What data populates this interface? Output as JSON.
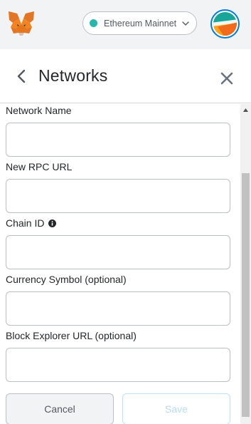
{
  "header": {
    "network": {
      "label": "Ethereum Mainnet",
      "dot_color": "#29b6af"
    },
    "logo_icon": "metamask-fox-icon",
    "avatar_icon": "account-identicon"
  },
  "page": {
    "title": "Networks",
    "back_icon": "chevron-left-icon",
    "close_icon": "close-icon"
  },
  "form": {
    "fields": [
      {
        "label": "Network Name",
        "value": "",
        "placeholder": ""
      },
      {
        "label": "New RPC URL",
        "value": "",
        "placeholder": ""
      },
      {
        "label": "Chain ID",
        "value": "",
        "placeholder": "",
        "info_icon": "info-icon"
      },
      {
        "label": "Currency Symbol (optional)",
        "value": "",
        "placeholder": ""
      },
      {
        "label": "Block Explorer URL (optional)",
        "value": "",
        "placeholder": ""
      }
    ],
    "cancel_label": "Cancel",
    "save_label": "Save"
  },
  "colors": {
    "accent": "#037dd6",
    "save_disabled_text": "#b9dcf5"
  }
}
